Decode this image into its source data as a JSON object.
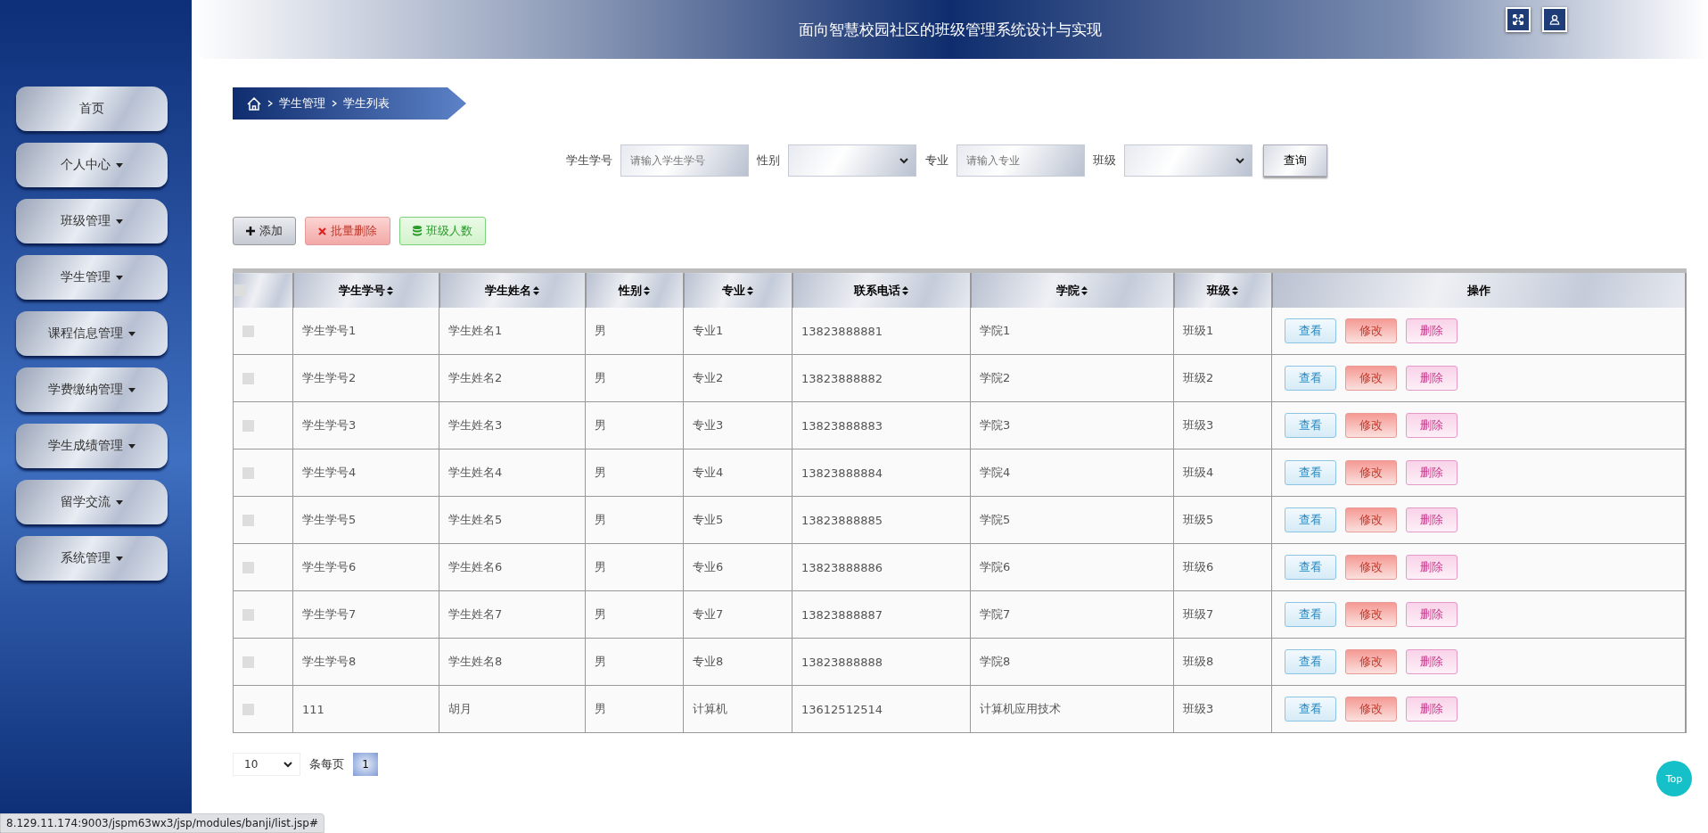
{
  "header": {
    "title": "面向智慧校园社区的班级管理系统设计与实现"
  },
  "sidebar": {
    "items": [
      {
        "label": "首页",
        "dropdown": false
      },
      {
        "label": "个人中心",
        "dropdown": true
      },
      {
        "label": "班级管理",
        "dropdown": true
      },
      {
        "label": "学生管理",
        "dropdown": true
      },
      {
        "label": "课程信息管理",
        "dropdown": true
      },
      {
        "label": "学费缴纳管理",
        "dropdown": true
      },
      {
        "label": "学生成绩管理",
        "dropdown": true
      },
      {
        "label": "留学交流",
        "dropdown": true
      },
      {
        "label": "系统管理",
        "dropdown": true
      }
    ]
  },
  "breadcrumb": [
    "学生管理",
    "学生列表"
  ],
  "search": {
    "fields": [
      {
        "label": "学生学号",
        "kind": "text",
        "placeholder": "请输入学生学号"
      },
      {
        "label": "性别",
        "kind": "select"
      },
      {
        "label": "专业",
        "kind": "text",
        "placeholder": "请输入专业"
      },
      {
        "label": "班级",
        "kind": "select"
      }
    ],
    "button": "查询"
  },
  "toolbar": [
    {
      "label": "添加",
      "kind": "add"
    },
    {
      "label": "批量删除",
      "kind": "delete"
    },
    {
      "label": "班级人数",
      "kind": "count"
    }
  ],
  "table": {
    "header_checked": false,
    "columns": [
      "学生学号",
      "学生姓名",
      "性别",
      "专业",
      "联系电话",
      "学院",
      "班级",
      "操作"
    ],
    "rows": [
      {
        "checked": false,
        "cells": [
          "学生学号1",
          "学生姓名1",
          "男",
          "专业1",
          "13823888881",
          "学院1",
          "班级1"
        ],
        "actions": [
          {
            "label": "查看",
            "kind": "view"
          },
          {
            "label": "修改",
            "kind": "edit"
          },
          {
            "label": "删除",
            "kind": "delete"
          }
        ]
      },
      {
        "checked": false,
        "cells": [
          "学生学号2",
          "学生姓名2",
          "男",
          "专业2",
          "13823888882",
          "学院2",
          "班级2"
        ],
        "actions": [
          {
            "label": "查看",
            "kind": "view"
          },
          {
            "label": "修改",
            "kind": "edit"
          },
          {
            "label": "删除",
            "kind": "delete"
          }
        ]
      },
      {
        "checked": false,
        "cells": [
          "学生学号3",
          "学生姓名3",
          "男",
          "专业3",
          "13823888883",
          "学院3",
          "班级3"
        ],
        "actions": [
          {
            "label": "查看",
            "kind": "view"
          },
          {
            "label": "修改",
            "kind": "edit"
          },
          {
            "label": "删除",
            "kind": "delete"
          }
        ]
      },
      {
        "checked": false,
        "cells": [
          "学生学号4",
          "学生姓名4",
          "男",
          "专业4",
          "13823888884",
          "学院4",
          "班级4"
        ],
        "actions": [
          {
            "label": "查看",
            "kind": "view"
          },
          {
            "label": "修改",
            "kind": "edit"
          },
          {
            "label": "删除",
            "kind": "delete"
          }
        ]
      },
      {
        "checked": false,
        "cells": [
          "学生学号5",
          "学生姓名5",
          "男",
          "专业5",
          "13823888885",
          "学院5",
          "班级5"
        ],
        "actions": [
          {
            "label": "查看",
            "kind": "view"
          },
          {
            "label": "修改",
            "kind": "edit"
          },
          {
            "label": "删除",
            "kind": "delete"
          }
        ]
      },
      {
        "checked": false,
        "cells": [
          "学生学号6",
          "学生姓名6",
          "男",
          "专业6",
          "13823888886",
          "学院6",
          "班级6"
        ],
        "actions": [
          {
            "label": "查看",
            "kind": "view"
          },
          {
            "label": "修改",
            "kind": "edit"
          },
          {
            "label": "删除",
            "kind": "delete"
          }
        ]
      },
      {
        "checked": false,
        "cells": [
          "学生学号7",
          "学生姓名7",
          "男",
          "专业7",
          "13823888887",
          "学院7",
          "班级7"
        ],
        "actions": [
          {
            "label": "查看",
            "kind": "view"
          },
          {
            "label": "修改",
            "kind": "edit"
          },
          {
            "label": "删除",
            "kind": "delete"
          }
        ]
      },
      {
        "checked": false,
        "cells": [
          "学生学号8",
          "学生姓名8",
          "男",
          "专业8",
          "13823888888",
          "学院8",
          "班级8"
        ],
        "actions": [
          {
            "label": "查看",
            "kind": "view"
          },
          {
            "label": "修改",
            "kind": "edit"
          },
          {
            "label": "删除",
            "kind": "delete"
          }
        ]
      },
      {
        "checked": false,
        "cells": [
          "111",
          "胡月",
          "男",
          "计算机",
          "13612512514",
          "计算机应用技术",
          "班级3"
        ],
        "actions": [
          {
            "label": "查看",
            "kind": "view"
          },
          {
            "label": "修改",
            "kind": "edit"
          },
          {
            "label": "删除",
            "kind": "delete"
          }
        ]
      }
    ]
  },
  "pagination": {
    "page_size": "10",
    "size_label": "条每页",
    "pages": [
      {
        "label": "1",
        "selected": true
      }
    ]
  },
  "top_button": "Top",
  "status_bar": "8.129.11.174:9003/jspm63wx3/jsp/modules/banji/list.jsp#"
}
